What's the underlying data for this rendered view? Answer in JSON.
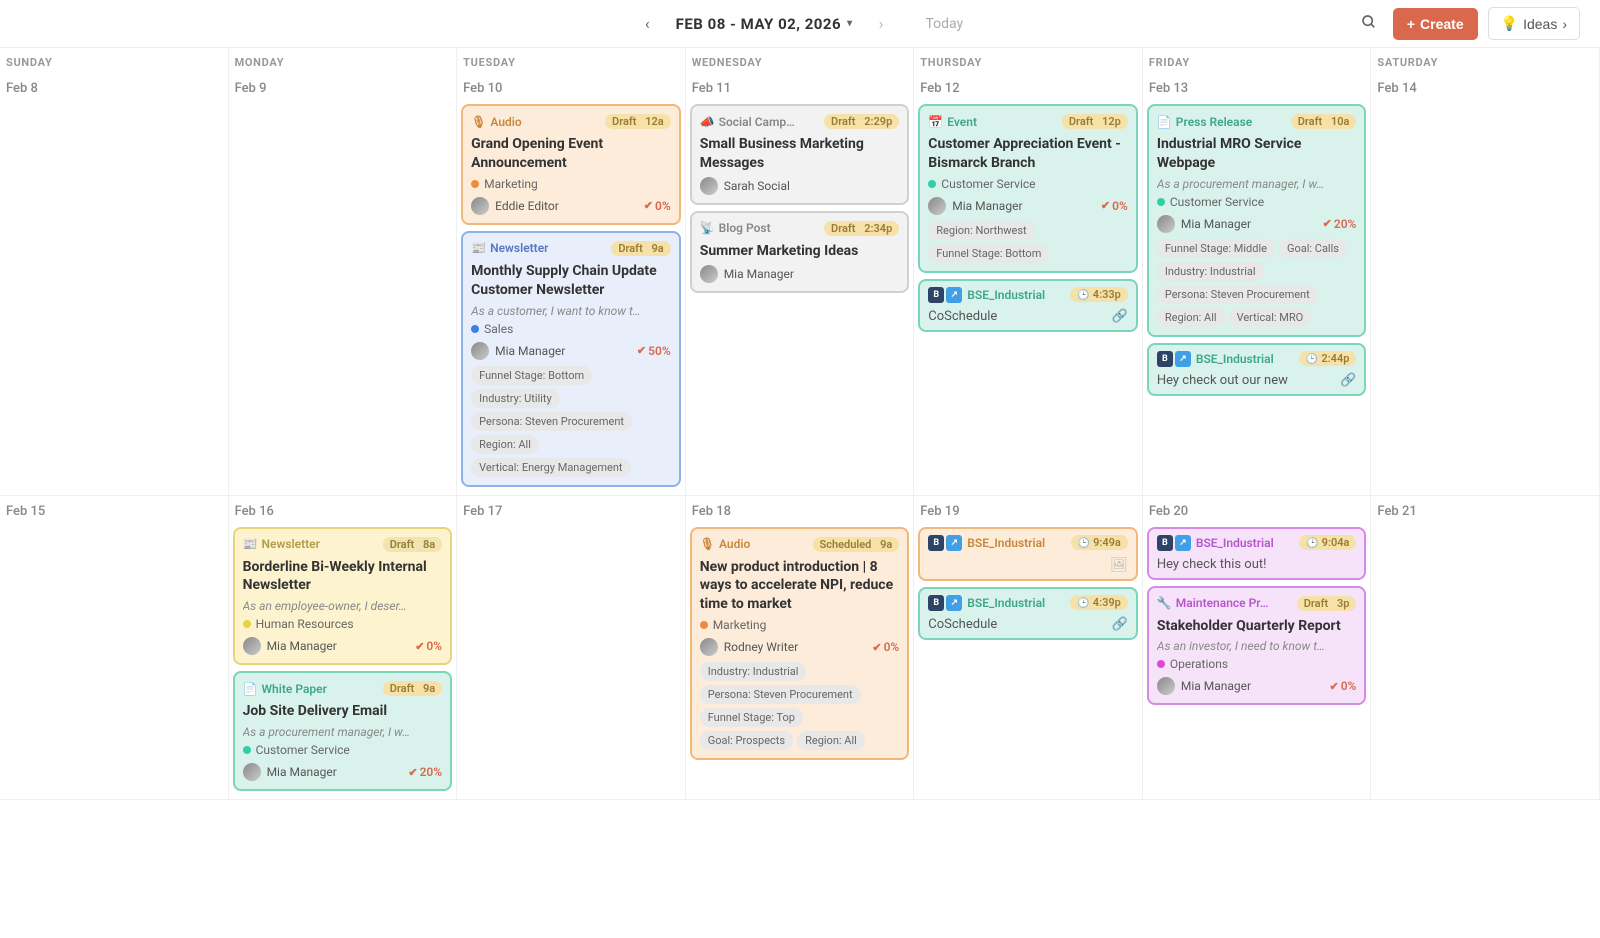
{
  "header": {
    "date_range": "FEB 08 - MAY 02, 2026",
    "today": "Today",
    "create": "Create",
    "ideas": "Ideas"
  },
  "weekdays": [
    "SUNDAY",
    "MONDAY",
    "TUESDAY",
    "WEDNESDAY",
    "THURSDAY",
    "FRIDAY",
    "SATURDAY"
  ],
  "week1": {
    "dates": [
      "Feb 8",
      "Feb 9",
      "Feb 10",
      "Feb 11",
      "Feb 12",
      "Feb 13",
      "Feb 14"
    ],
    "tue": {
      "audio": {
        "type": "Audio",
        "status": "Draft",
        "time": "12a",
        "title": "Grand Opening Event Announcement",
        "category": "Marketing",
        "catColor": "#f08b3c",
        "assignee": "Eddie Editor",
        "progress": "0%"
      },
      "news": {
        "type": "Newsletter",
        "status": "Draft",
        "time": "9a",
        "title": "Monthly Supply Chain Update Customer Newsletter",
        "desc": "As a customer, I want to know t…",
        "category": "Sales",
        "catColor": "#3f7ee6",
        "assignee": "Mia Manager",
        "progress": "50%",
        "tags": [
          "Funnel Stage: Bottom",
          "Industry: Utility",
          "Persona: Steven Procurement",
          "Region: All",
          "Vertical: Energy Management"
        ]
      }
    },
    "wed": {
      "soc": {
        "type": "Social Camp…",
        "status": "Draft",
        "time": "2:29p",
        "title": "Small Business Marketing Messages",
        "assignee": "Sarah Social"
      },
      "blog": {
        "type": "Blog Post",
        "status": "Draft",
        "time": "2:34p",
        "title": "Summer Marketing Ideas",
        "assignee": "Mia Manager"
      }
    },
    "thu": {
      "event": {
        "type": "Event",
        "status": "Draft",
        "time": "12p",
        "title": "Customer Appreciation Event - Bismarck Branch",
        "category": "Customer Service",
        "catColor": "#2fd0a8",
        "assignee": "Mia Manager",
        "progress": "0%",
        "tags": [
          "Region: Northwest",
          "Funnel Stage: Bottom"
        ]
      },
      "soc": {
        "handle": "BSE_Industrial",
        "time": "4:33p",
        "text": "CoSchedule"
      }
    },
    "fri": {
      "press": {
        "type": "Press Release",
        "status": "Draft",
        "time": "10a",
        "title": "Industrial MRO Service Webpage",
        "desc": "As a procurement manager, I w…",
        "category": "Customer Service",
        "catColor": "#2fd0a8",
        "assignee": "Mia Manager",
        "progress": "20%",
        "tags": [
          "Funnel Stage: Middle",
          "Goal: Calls",
          "Industry: Industrial",
          "Persona: Steven Procurement",
          "Region: All",
          "Vertical: MRO"
        ]
      },
      "soc": {
        "handle": "BSE_Industrial",
        "time": "2:44p",
        "text": "Hey check out our new"
      }
    }
  },
  "week2": {
    "dates": [
      "Feb 15",
      "Feb 16",
      "Feb 17",
      "Feb 18",
      "Feb 19",
      "Feb 20",
      "Feb 21"
    ],
    "mon": {
      "news": {
        "type": "Newsletter",
        "status": "Draft",
        "time": "8a",
        "title": "Borderline Bi-Weekly Internal Newsletter",
        "desc": "As an employee-owner, I deser…",
        "category": "Human Resources",
        "catColor": "#e8d43c",
        "assignee": "Mia Manager",
        "progress": "0%"
      },
      "wp": {
        "type": "White Paper",
        "status": "Draft",
        "time": "9a",
        "title": "Job Site Delivery Email",
        "desc": "As a procurement manager, I w…",
        "category": "Customer Service",
        "catColor": "#2fd0a8",
        "assignee": "Mia Manager",
        "progress": "20%"
      }
    },
    "wed": {
      "audio": {
        "type": "Audio",
        "status": "Scheduled",
        "time": "9a",
        "title": "New product introduction | 8 ways to accelerate NPI, reduce time to market",
        "category": "Marketing",
        "catColor": "#f08b3c",
        "assignee": "Rodney Writer",
        "progress": "0%",
        "tags": [
          "Industry: Industrial",
          "Persona: Steven Procurement",
          "Funnel Stage: Top",
          "Goal: Prospects",
          "Region: All"
        ]
      }
    },
    "thu": {
      "soc1": {
        "handle": "BSE_Industrial",
        "time": "9:49a"
      },
      "soc2": {
        "handle": "BSE_Industrial",
        "time": "4:39p",
        "text": "CoSchedule"
      }
    },
    "fri": {
      "soc": {
        "handle": "BSE_Industrial",
        "time": "9:04a",
        "text": "Hey check this out!"
      },
      "maint": {
        "type": "Maintenance Pr…",
        "status": "Draft",
        "time": "3p",
        "title": "Stakeholder Quarterly Report",
        "desc": "As an investor, I need to know t…",
        "category": "Operations",
        "catColor": "#d948d9",
        "assignee": "Mia Manager",
        "progress": "0%"
      }
    }
  }
}
